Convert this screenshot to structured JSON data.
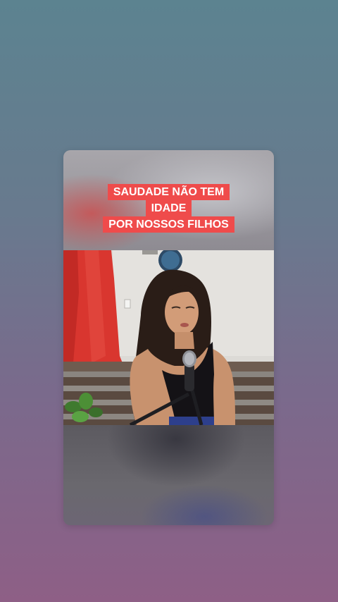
{
  "video_caption": {
    "lines": [
      "SAUDADE NÃO TEM",
      "IDADE",
      "POR NOSSOS FILHOS"
    ]
  },
  "colors": {
    "caption_bg": "#ef4b4b",
    "caption_text": "#ffffff",
    "background_top": "#5c8390",
    "background_bottom": "#8e5f86"
  },
  "scene": {
    "description_icon": "singer-with-microphone"
  }
}
